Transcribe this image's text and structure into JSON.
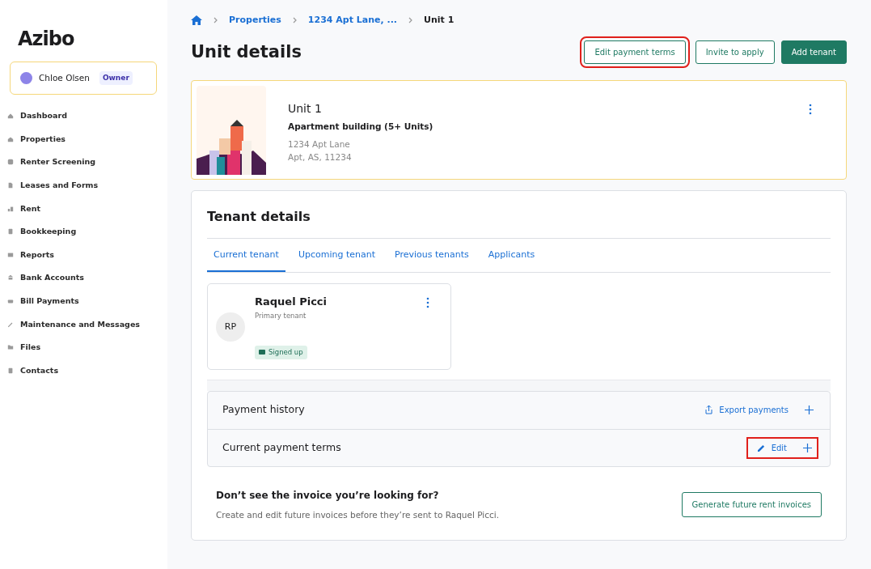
{
  "sidebar": {
    "logo": "Azibo",
    "user": {
      "name": "Chloe Olsen",
      "role": "Owner"
    },
    "items": [
      {
        "label": "Dashboard",
        "selected": false
      },
      {
        "label": "Properties",
        "selected": false
      },
      {
        "label": "Renter Screening",
        "selected": false
      },
      {
        "label": "Leases and Forms",
        "selected": false
      },
      {
        "label": "Rent",
        "selected": false
      },
      {
        "label": "Bookkeeping",
        "selected": false
      },
      {
        "label": "Reports",
        "selected": false
      },
      {
        "label": "Bank Accounts",
        "selected": false
      },
      {
        "label": "Bill Payments",
        "selected": false
      },
      {
        "label": "Maintenance and Messages",
        "selected": false
      },
      {
        "label": "Files",
        "selected": false
      },
      {
        "label": "Contacts",
        "selected": false
      }
    ]
  },
  "breadcrumb": [
    {
      "label": "Properties",
      "kind": "link"
    },
    {
      "label": "1234 Apt Lane, ...",
      "kind": "link"
    },
    {
      "label": "Unit 1",
      "kind": "current"
    }
  ],
  "page_title": "Unit details",
  "actions": [
    {
      "label": "Edit payment terms",
      "kind": "outline",
      "highlighted": true
    },
    {
      "label": "Invite to apply",
      "kind": "outline",
      "highlighted": false
    },
    {
      "label": "Add tenant",
      "kind": "solid",
      "highlighted": false
    }
  ],
  "unit": {
    "name": "Unit 1",
    "type": "Apartment building (5+ Units)",
    "address_line1": "1234 Apt Lane",
    "address_line2": "Apt, AS, 11234"
  },
  "tenant_details": {
    "title": "Tenant details",
    "tabs": [
      {
        "label": "Current tenant",
        "selected": true
      },
      {
        "label": "Upcoming tenant",
        "selected": false
      },
      {
        "label": "Previous tenants",
        "selected": false
      },
      {
        "label": "Applicants",
        "selected": false
      }
    ],
    "tenant": {
      "initials": "RP",
      "name": "Raquel Picci",
      "role": "Primary tenant",
      "status": "Signed up"
    },
    "sections": [
      {
        "title": "Payment history",
        "action": "Export payments",
        "kind": "export",
        "highlighted": false
      },
      {
        "title": "Current payment terms",
        "action": "Edit",
        "kind": "edit",
        "highlighted": true
      }
    ],
    "invoice_prompt": {
      "heading": "Don’t see the invoice you’re looking for?",
      "text": "Create and edit future invoices before they’re sent to Raquel Picci.",
      "button": "Generate future rent invoices"
    }
  }
}
